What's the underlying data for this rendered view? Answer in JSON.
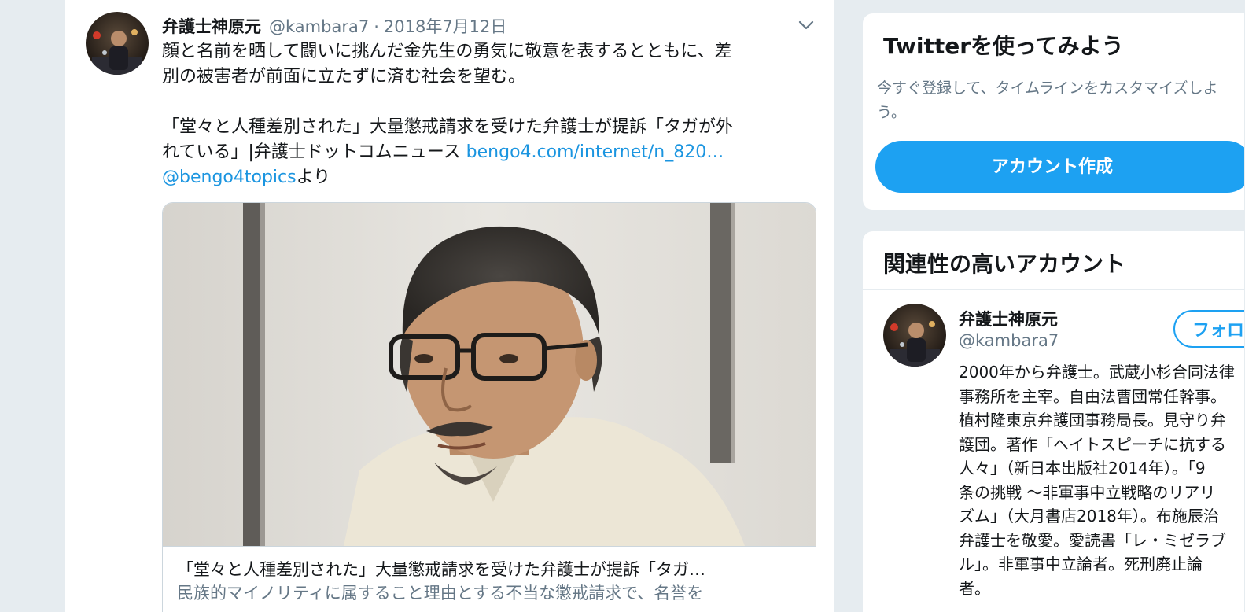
{
  "tweet": {
    "author_name": "弁護士神原元",
    "author_handle": "@kambara7",
    "separator": "·",
    "date": "2018年7月12日",
    "text_lines": [
      "顔と名前を晒して闘いに挑んだ金先生の勇気に敬意を表するとともに、差",
      "別の被害者が前面に立たずに済む社会を望む。"
    ],
    "article_line1": "「堂々と人種差別された」大量懲戒請求を受けた弁護士が提訴「タガが外",
    "article_line2_prefix": "れている」|弁護士ドットコムニュース ",
    "article_link": "bengo4.com/internet/n_820…",
    "mention": "@bengo4topics",
    "mention_suffix": "より",
    "card": {
      "title": "「堂々と人種差別された」大量懲戒請求を受けた弁護士が提訴「タガ…",
      "description": "民族的マイノリティに属すること理由とする不当な懲戒請求で、名誉を"
    }
  },
  "sidebar": {
    "signup": {
      "title": "Twitterを使ってみよう",
      "text": "今すぐ登録して、タイムラインをカスタマイズしよう。",
      "button_label": "アカウント作成"
    },
    "related": {
      "title": "関連性の高いアカウント",
      "account": {
        "name": "弁護士神原元",
        "handle": "@kambara7",
        "follow_label": "フォロー",
        "bio_lines": [
          "2000年から弁護士。武蔵小杉合同法律",
          "事務所を主宰。自由法曹団常任幹事。",
          "植村隆東京弁護団事務局長。見守り弁",
          "護団。著作「ヘイトスピーチに抗する",
          "人々」（新日本出版社2014年）。「9",
          "条の挑戦 ～非軍事中立戦略のリアリ",
          "ズム」（大月書店2018年）。布施辰治",
          "弁護士を敬愛。愛読書「レ・ミゼラブ",
          "ル」。非軍事中立論者。死刑廃止論",
          "者。"
        ]
      }
    }
  },
  "colors": {
    "accent": "#1da1f2",
    "link": "#1b95e0",
    "secondary_text": "#657786",
    "border": "#e6ecf0"
  },
  "icons": {
    "caret": "chevron-down-icon"
  }
}
